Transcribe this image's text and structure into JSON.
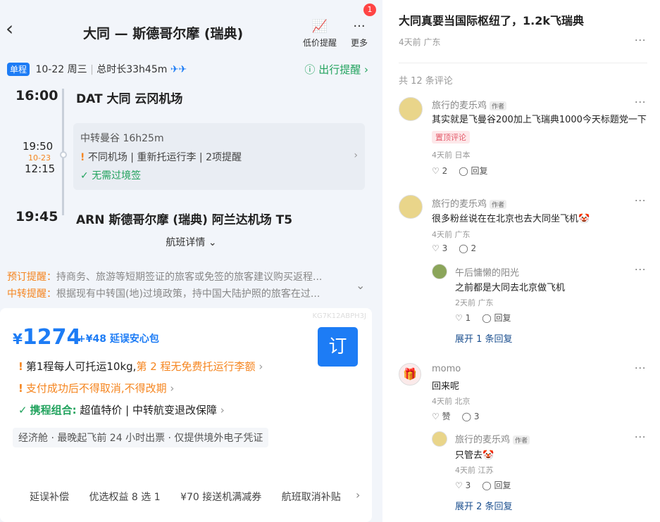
{
  "flight": {
    "header": {
      "title": "大同 — 斯德哥尔摩 (瑞典)",
      "low_price_label": "低价提醒",
      "more_label": "更多",
      "badge_count": "1"
    },
    "trip": {
      "type_tag": "单程",
      "date": "10-22 周三",
      "duration": "总时长33h45m",
      "plane_icons": "✈✈",
      "reminder": "出行提醒"
    },
    "depart": {
      "time": "16:00",
      "airport": "DAT 大同 云冈机场"
    },
    "transfer": {
      "arrive_time": "19:50",
      "next_day": "10-23",
      "depart_time": "12:15",
      "summary": "中转曼谷 16h25m",
      "warnings": "不同机场 | 重新托运行李 | 2项提醒",
      "visa": "无需过境签"
    },
    "arrive": {
      "time": "19:45",
      "airport": "ARN 斯德哥尔摩 (瑞典) 阿兰达机场 T5"
    },
    "detail_link": "航班详情",
    "notices": [
      {
        "label": "预订提醒：",
        "text": "持商务、旅游等短期签证的旅客或免签的旅客建议购买返程..."
      },
      {
        "label": "中转提醒：",
        "text": "根据现有中转国(地)过境政策，持中国大陆护照的旅客在过..."
      }
    ],
    "offer": {
      "code": "KG7K12ABPH3J",
      "currency": "¥",
      "price": "1274",
      "addon": "+¥48 延误安心包",
      "book_label": "订",
      "line1_a": "第1程每人可托运10kg,",
      "line1_b": "第 2 程无免费托运行李额",
      "line2": "支付成功后不得取消,不得改期",
      "line3_a": "携程组合:",
      "line3_b": "超值特价 | 中转航变退改保障",
      "economy": "经济舱 · 最晚起飞前 24 小时出票 · 仅提供境外电子凭证",
      "chips": [
        "延误补偿",
        "优选权益 8 选 1",
        "¥70 接送机满减券",
        "航班取消补贴"
      ]
    }
  },
  "post": {
    "title": "大同真要当国际枢纽了，1.2k飞瑞典",
    "meta": "4天前 广东",
    "comments_count": "共 12 条评论",
    "author_tag": "作者",
    "comments": [
      {
        "user": "旅行的麦乐鸡",
        "text": "其实就是飞曼谷200加上飞瑞典1000今天标题党一下",
        "pinned": "置顶评论",
        "meta": "4天前 日本",
        "likes": "2",
        "reply": "回复"
      },
      {
        "user": "旅行的麦乐鸡",
        "text": "很多粉丝说在在北京也去大同坐飞机🤡",
        "meta": "4天前 广东",
        "likes": "3",
        "reply": "2"
      },
      {
        "user": "午后慵懒的阳光",
        "text": "之前都是大同去北京做飞机",
        "meta": "2天前 广东",
        "likes": "1",
        "reply": "回复",
        "expand": "展开 1 条回复"
      },
      {
        "user": "momo",
        "text": "回来呢",
        "meta": "4天前 北京",
        "likes": "赞",
        "reply": "3"
      },
      {
        "user": "旅行的麦乐鸡",
        "text": "只管去🤡",
        "meta": "4天前 江苏",
        "likes": "3",
        "reply": "回复",
        "expand": "展开 2 条回复"
      }
    ]
  }
}
